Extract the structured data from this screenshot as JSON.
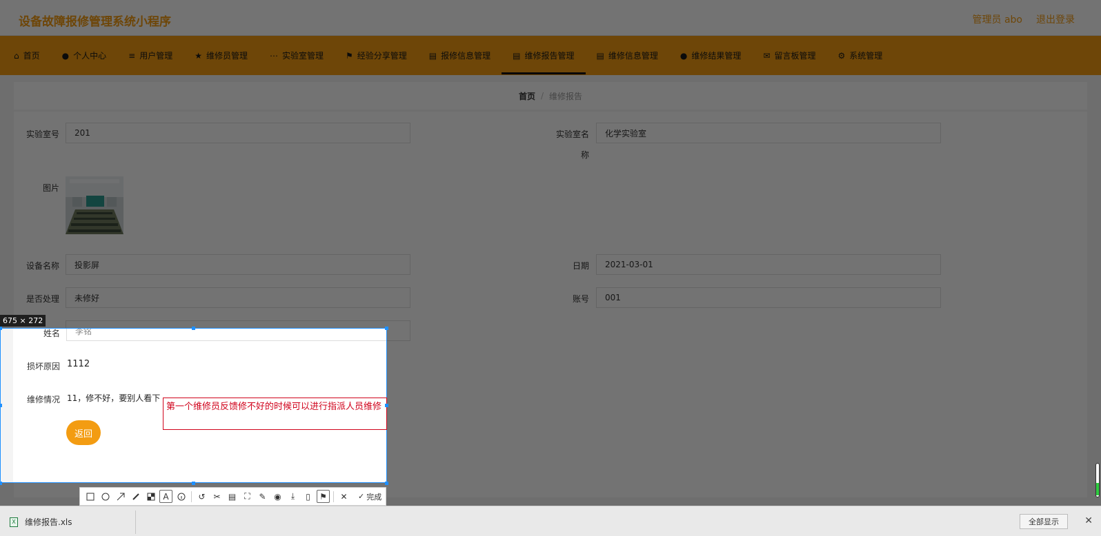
{
  "colors": {
    "accent": "#f39c12",
    "accent_dark": "#d4800a",
    "nav_text": "#1a1a1a",
    "active_underline": "#111111",
    "annotation_red": "#d0021b",
    "selection_blue": "#1e90ff"
  },
  "header": {
    "app_title": "设备故障报修管理系统小程序",
    "user_label": "管理员 abo",
    "logout_label": "退出登录"
  },
  "nav": {
    "items": [
      {
        "label": "首页",
        "icon": "home-icon"
      },
      {
        "label": "个人中心",
        "icon": "user-icon"
      },
      {
        "label": "用户管理",
        "icon": "list-icon"
      },
      {
        "label": "维修员管理",
        "icon": "star-icon"
      },
      {
        "label": "实验室管理",
        "icon": "grid-icon"
      },
      {
        "label": "经验分享管理",
        "icon": "flag-icon"
      },
      {
        "label": "报修信息管理",
        "icon": "doc-icon"
      },
      {
        "label": "维修报告管理",
        "icon": "doc-icon"
      },
      {
        "label": "维修信息管理",
        "icon": "doc-icon"
      },
      {
        "label": "维修结果管理",
        "icon": "user-icon"
      },
      {
        "label": "留言板管理",
        "icon": "message-icon"
      },
      {
        "label": "系统管理",
        "icon": "gear-icon"
      }
    ],
    "active_index": 7
  },
  "breadcrumb": {
    "home": "首页",
    "separator": "/",
    "current": "维修报告"
  },
  "form": {
    "lab_no_label": "实验室号",
    "lab_no_value": "201",
    "lab_name_label_1": "实验室名",
    "lab_name_label_2": "称",
    "lab_name_value": "化学实验室",
    "image_label": "图片",
    "device_label": "设备名称",
    "device_value": "投影屏",
    "date_label": "日期",
    "date_value": "2021-03-01",
    "processed_label": "是否处理",
    "processed_value": "未修好",
    "account_label": "账号",
    "account_value": "001",
    "name_label": "姓名",
    "name_value": "李铭",
    "cause_label": "损坏原因",
    "cause_value": "1112",
    "repair_label": "维修情况",
    "repair_value": "11，修不好，要别人看下",
    "back_button": "返回"
  },
  "screenshot_tool": {
    "size_readout": "675 × 272",
    "annotation_text": "第一个维修员反馈修不好的时候可以进行指派人员维修",
    "done_label": "完成",
    "font_size_value": "12",
    "current_color": "#ff0000",
    "palette": [
      "#000000",
      "#808080",
      "#800000",
      "#ff8040",
      "#408040",
      "#4040ff",
      "#800080",
      "#00a0a0",
      "#ffffff",
      "#c0c0c0",
      "#ff0000",
      "#ffff00",
      "#80ff00",
      "#0080ff",
      "#ff00ff",
      "#00ffff"
    ]
  },
  "download_bar": {
    "file_name": "维修报告.xls",
    "show_all": "全部显示"
  }
}
